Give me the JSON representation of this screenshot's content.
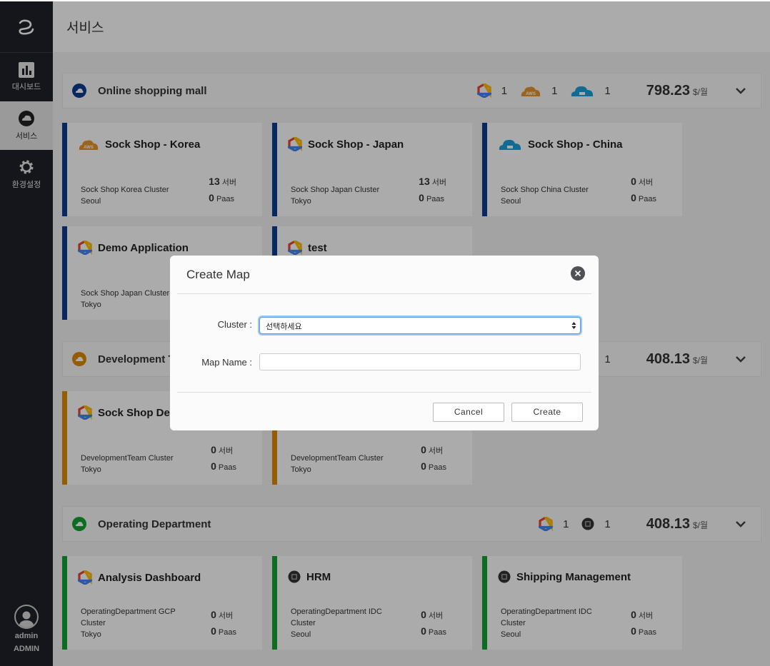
{
  "sidebar": {
    "items": [
      {
        "label": "대시보드",
        "icon": "bar-chart-icon"
      },
      {
        "label": "서비스",
        "icon": "cloud-icon"
      },
      {
        "label": "환경설정",
        "icon": "gear-icon"
      }
    ],
    "user": {
      "name": "admin",
      "role": "ADMIN"
    }
  },
  "page": {
    "title": "서비스"
  },
  "sections": [
    {
      "title": "Online shopping mall",
      "badges": [
        "1",
        "1",
        "1"
      ],
      "price": "798.23",
      "unit": "$/월",
      "color": "#0b3c8f"
    },
    {
      "title": "Development Team",
      "badges": [
        "1"
      ],
      "price": "408.13",
      "unit": "$/월",
      "color": "#e08a00"
    },
    {
      "title": "Operating Department",
      "badges": [
        "1",
        "1"
      ],
      "price": "408.13",
      "unit": "$/월",
      "color": "#12a232"
    }
  ],
  "cards": [
    {
      "title": "Sock Shop - Korea",
      "provider": "aws",
      "cluster": "Sock Shop Korea Cluster",
      "region": "Seoul",
      "servers": "13",
      "paas": "0"
    },
    {
      "title": "Sock Shop - Japan",
      "provider": "gcp",
      "cluster": "Sock Shop Japan Cluster",
      "region": "Tokyo",
      "servers": "13",
      "paas": "0"
    },
    {
      "title": "Sock Shop - China",
      "provider": "azure",
      "cluster": "Sock Shop China Cluster",
      "region": "Seoul",
      "servers": "0",
      "paas": "0"
    },
    {
      "title": "Demo Application",
      "provider": "gcp",
      "cluster": "Sock Shop Japan Cluster",
      "region": "Tokyo"
    },
    {
      "title": "test",
      "provider": "gcp"
    },
    {
      "title": "Sock Shop Dev",
      "provider": "gcp",
      "cluster": "DevelopmentTeam Cluster",
      "region": "Tokyo",
      "servers": "0",
      "paas": "0"
    },
    {
      "cluster": "DevelopmentTeam Cluster",
      "region": "Tokyo",
      "servers": "0",
      "paas": "0"
    },
    {
      "title": "Analysis Dashboard",
      "provider": "gcp",
      "cluster": "OperatingDepartment GCP Cluster",
      "region": "Tokyo",
      "servers": "0",
      "paas": "0"
    },
    {
      "title": "HRM",
      "provider": "idc",
      "cluster": "OperatingDepartment IDC Cluster",
      "region": "Seoul",
      "servers": "0",
      "paas": "0"
    },
    {
      "title": "Shipping Management",
      "provider": "idc",
      "cluster": "OperatingDepartment IDC Cluster",
      "region": "Seoul",
      "servers": "0",
      "paas": "0"
    }
  ],
  "labels": {
    "server_unit": "서버",
    "paas_unit": "Paas"
  },
  "modal": {
    "title": "Create Map",
    "cluster_label": "Cluster :",
    "cluster_value": "선택하세요",
    "map_name_label": "Map Name :",
    "map_name_value": "",
    "cancel_label": "Cancel",
    "create_label": "Create"
  },
  "colors": {
    "sidebar_bg": "#1f2229",
    "accent_blue": "#0b3c8f",
    "accent_orange": "#e08a00",
    "accent_green": "#12a232"
  }
}
